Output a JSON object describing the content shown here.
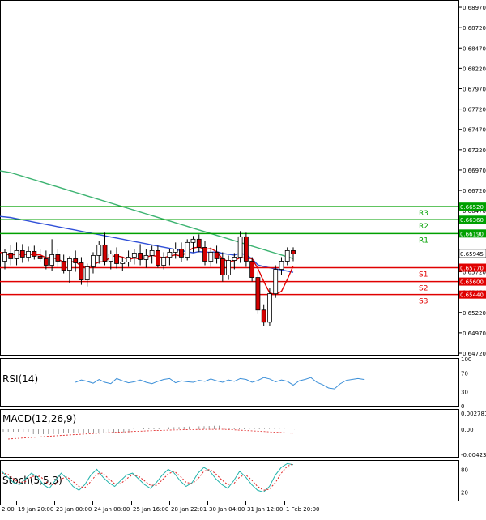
{
  "colors": {
    "background": "#ffffff",
    "frame": "#000000",
    "grid": "#c8c8c8",
    "up_candle": "#ffffff",
    "down_candle": "#d40000",
    "resistance": "#00a000",
    "support": "#e00000",
    "ma_slow": "#3cb371",
    "ma_fast": "#3050d8",
    "ma_red": "#e00000",
    "rsi": "#3b8fd8",
    "macd_signal": "#e02020",
    "stoch_main": "#20b2aa",
    "stoch_signal": "#e02020"
  },
  "price_axis": {
    "ticks": [
      "0.68970",
      "0.68720",
      "0.68470",
      "0.68220",
      "0.67970",
      "0.67720",
      "0.67470",
      "0.67220",
      "0.66970",
      "0.66720",
      "0.66470",
      "0.66220",
      "0.65970",
      "0.65720",
      "0.65470",
      "0.65220",
      "0.64970",
      "0.64720"
    ],
    "current_price": "0.65945"
  },
  "levels": [
    {
      "label": "R3",
      "value": "0.66520",
      "kind": "resistance"
    },
    {
      "label": "R2",
      "value": "0.66360",
      "kind": "resistance"
    },
    {
      "label": "R1",
      "value": "0.66190",
      "kind": "resistance"
    },
    {
      "label": "S1",
      "value": "0.65770",
      "kind": "support"
    },
    {
      "label": "S2",
      "value": "0.65600",
      "kind": "support"
    },
    {
      "label": "S3",
      "value": "0.65440",
      "kind": "support"
    }
  ],
  "chart_data": {
    "type": "candlestick",
    "y_range": [
      0.647,
      0.6906
    ],
    "candles": [
      {
        "o": 0.6585,
        "h": 0.66,
        "l": 0.6575,
        "c": 0.6596
      },
      {
        "o": 0.6595,
        "h": 0.6605,
        "l": 0.658,
        "c": 0.6588
      },
      {
        "o": 0.6588,
        "h": 0.6608,
        "l": 0.658,
        "c": 0.6598
      },
      {
        "o": 0.6598,
        "h": 0.6606,
        "l": 0.6583,
        "c": 0.659
      },
      {
        "o": 0.659,
        "h": 0.6603,
        "l": 0.6585,
        "c": 0.6597
      },
      {
        "o": 0.6597,
        "h": 0.6604,
        "l": 0.6587,
        "c": 0.6591
      },
      {
        "o": 0.6591,
        "h": 0.66,
        "l": 0.6584,
        "c": 0.6588
      },
      {
        "o": 0.6588,
        "h": 0.6598,
        "l": 0.6575,
        "c": 0.658
      },
      {
        "o": 0.658,
        "h": 0.6612,
        "l": 0.6573,
        "c": 0.6593
      },
      {
        "o": 0.6593,
        "h": 0.66,
        "l": 0.6578,
        "c": 0.6585
      },
      {
        "o": 0.6585,
        "h": 0.6593,
        "l": 0.657,
        "c": 0.6574
      },
      {
        "o": 0.6574,
        "h": 0.6591,
        "l": 0.6558,
        "c": 0.6588
      },
      {
        "o": 0.6588,
        "h": 0.6598,
        "l": 0.6572,
        "c": 0.6583
      },
      {
        "o": 0.6583,
        "h": 0.659,
        "l": 0.6556,
        "c": 0.6562
      },
      {
        "o": 0.6562,
        "h": 0.6582,
        "l": 0.6554,
        "c": 0.6578
      },
      {
        "o": 0.6578,
        "h": 0.6596,
        "l": 0.657,
        "c": 0.6592
      },
      {
        "o": 0.6592,
        "h": 0.661,
        "l": 0.6582,
        "c": 0.6605
      },
      {
        "o": 0.6605,
        "h": 0.662,
        "l": 0.658,
        "c": 0.6585
      },
      {
        "o": 0.6585,
        "h": 0.6598,
        "l": 0.6575,
        "c": 0.6594
      },
      {
        "o": 0.6594,
        "h": 0.6602,
        "l": 0.6576,
        "c": 0.6582
      },
      {
        "o": 0.6582,
        "h": 0.659,
        "l": 0.6573,
        "c": 0.6584
      },
      {
        "o": 0.6584,
        "h": 0.6598,
        "l": 0.6578,
        "c": 0.659
      },
      {
        "o": 0.659,
        "h": 0.66,
        "l": 0.6581,
        "c": 0.6595
      },
      {
        "o": 0.6595,
        "h": 0.6606,
        "l": 0.658,
        "c": 0.6587
      },
      {
        "o": 0.6587,
        "h": 0.66,
        "l": 0.6577,
        "c": 0.6592
      },
      {
        "o": 0.6592,
        "h": 0.6604,
        "l": 0.6582,
        "c": 0.6598
      },
      {
        "o": 0.6598,
        "h": 0.6604,
        "l": 0.6577,
        "c": 0.658
      },
      {
        "o": 0.658,
        "h": 0.6596,
        "l": 0.6575,
        "c": 0.659
      },
      {
        "o": 0.659,
        "h": 0.66,
        "l": 0.658,
        "c": 0.6596
      },
      {
        "o": 0.6596,
        "h": 0.6608,
        "l": 0.6588,
        "c": 0.66
      },
      {
        "o": 0.66,
        "h": 0.6608,
        "l": 0.6584,
        "c": 0.659
      },
      {
        "o": 0.659,
        "h": 0.6612,
        "l": 0.6586,
        "c": 0.6608
      },
      {
        "o": 0.6608,
        "h": 0.6616,
        "l": 0.6596,
        "c": 0.6612
      },
      {
        "o": 0.6612,
        "h": 0.6618,
        "l": 0.6596,
        "c": 0.6602
      },
      {
        "o": 0.6602,
        "h": 0.661,
        "l": 0.658,
        "c": 0.6585
      },
      {
        "o": 0.6585,
        "h": 0.6602,
        "l": 0.6578,
        "c": 0.6596
      },
      {
        "o": 0.6596,
        "h": 0.6604,
        "l": 0.6582,
        "c": 0.6588
      },
      {
        "o": 0.6588,
        "h": 0.6596,
        "l": 0.656,
        "c": 0.6568
      },
      {
        "o": 0.6568,
        "h": 0.6592,
        "l": 0.6562,
        "c": 0.6586
      },
      {
        "o": 0.6586,
        "h": 0.6595,
        "l": 0.6575,
        "c": 0.659
      },
      {
        "o": 0.659,
        "h": 0.6622,
        "l": 0.6583,
        "c": 0.6615
      },
      {
        "o": 0.6615,
        "h": 0.662,
        "l": 0.6578,
        "c": 0.6585
      },
      {
        "o": 0.6585,
        "h": 0.659,
        "l": 0.656,
        "c": 0.6565
      },
      {
        "o": 0.6565,
        "h": 0.6572,
        "l": 0.652,
        "c": 0.6525
      },
      {
        "o": 0.6525,
        "h": 0.6532,
        "l": 0.6505,
        "c": 0.651
      },
      {
        "o": 0.651,
        "h": 0.6552,
        "l": 0.6505,
        "c": 0.6545
      },
      {
        "o": 0.6545,
        "h": 0.658,
        "l": 0.654,
        "c": 0.6575
      },
      {
        "o": 0.6575,
        "h": 0.659,
        "l": 0.6568,
        "c": 0.6585
      },
      {
        "o": 0.6585,
        "h": 0.6602,
        "l": 0.658,
        "c": 0.6598
      },
      {
        "o": 0.6598,
        "h": 0.6602,
        "l": 0.6585,
        "c": 0.6594
      }
    ],
    "x_labels": [
      "2:00",
      "19 Jan 20:00",
      "23 Jan 00:00",
      "24 Jan 08:00",
      "25 Jan 16:00",
      "28 Jan 22:01",
      "30 Jan 04:00",
      "31 Jan 12:00",
      "1 Feb 20:00"
    ],
    "indicators": {
      "rsi": {
        "label": "RSI(14)",
        "axis_ticks": [
          "100",
          "70",
          "30",
          "0"
        ],
        "values": [
          50,
          55,
          52,
          48,
          56,
          50,
          47,
          58,
          53,
          49,
          51,
          55,
          50,
          47,
          52,
          56,
          58,
          49,
          53,
          51,
          50,
          54,
          52,
          57,
          53,
          50,
          55,
          52,
          58,
          56,
          50,
          54,
          60,
          57,
          51,
          55,
          52,
          44,
          53,
          56,
          60,
          50,
          45,
          38,
          36,
          47,
          54,
          56,
          58,
          56
        ]
      },
      "macd": {
        "label": "MACD(12,26,9)",
        "axis_ticks": [
          "0.002781",
          "0.00",
          "-0.004236"
        ]
      },
      "stoch": {
        "label": "Stoch(5,5,3)",
        "axis_ticks": [
          "80",
          "20"
        ],
        "main": [
          75,
          60,
          45,
          40,
          55,
          70,
          60,
          40,
          30,
          50,
          70,
          55,
          35,
          25,
          40,
          65,
          80,
          60,
          45,
          35,
          50,
          65,
          70,
          55,
          40,
          30,
          45,
          65,
          80,
          70,
          50,
          35,
          45,
          70,
          85,
          75,
          55,
          40,
          30,
          50,
          75,
          60,
          40,
          25,
          20,
          35,
          65,
          85,
          95,
          92
        ],
        "signal": [
          70,
          68,
          55,
          45,
          48,
          60,
          65,
          55,
          40,
          40,
          55,
          60,
          48,
          35,
          32,
          48,
          68,
          70,
          55,
          42,
          42,
          55,
          66,
          62,
          50,
          38,
          38,
          52,
          68,
          75,
          62,
          46,
          42,
          55,
          75,
          80,
          68,
          52,
          40,
          42,
          60,
          66,
          52,
          35,
          25,
          28,
          45,
          70,
          88,
          94
        ]
      }
    }
  }
}
